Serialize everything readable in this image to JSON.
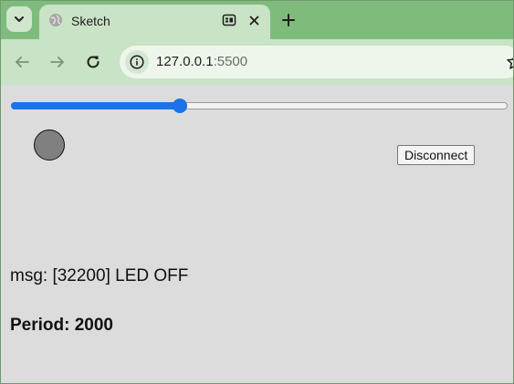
{
  "browser": {
    "tab": {
      "title": "Sketch",
      "favicon": "globe-icon",
      "media_icon": "media-control-icon",
      "close_icon": "close-icon"
    },
    "tab_search_icon": "chevron-down-icon",
    "new_tab_icon": "plus-icon",
    "nav": {
      "back_icon": "back-arrow-icon",
      "forward_icon": "forward-arrow-icon",
      "reload_icon": "reload-icon"
    },
    "omnibox": {
      "site_info_icon": "info-icon",
      "host": "127.0.0.1",
      "port": ":5500",
      "bookmark_icon": "star-icon"
    },
    "colors": {
      "frame": "#7fbc7c",
      "toolbar": "#c8e3c5",
      "page_background": "#dcdcdc",
      "slider_accent": "#1a73e8",
      "led_off": "#808080"
    }
  },
  "page": {
    "slider": {
      "min": 0,
      "max": 100,
      "value": 34
    },
    "led_indicator": {
      "state": "off"
    },
    "disconnect_button": {
      "label": "Disconnect"
    },
    "msg_text": "msg: [32200]  LED OFF",
    "period_text": "Period: 2000"
  }
}
